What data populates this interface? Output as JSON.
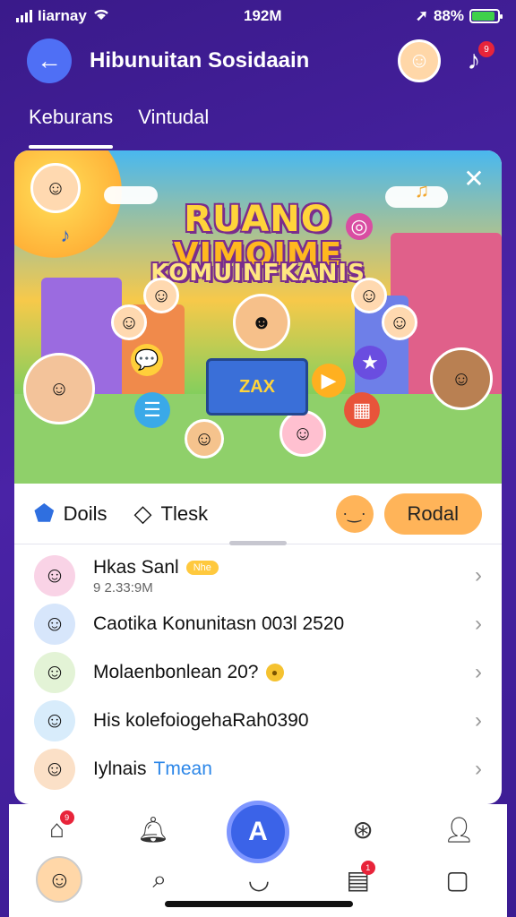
{
  "status_bar": {
    "carrier": "Iiarnay",
    "time": "192M",
    "battery": "88%",
    "battery_level": 0.88
  },
  "header": {
    "title": "Hibunuitan Sosidaain",
    "music_badge": "9"
  },
  "tabs": [
    {
      "label": "Keburans",
      "active": true
    },
    {
      "label": "Vintudal",
      "active": false
    }
  ],
  "banner": {
    "title_line1": "RUANO",
    "title_line2": "VIMOIME",
    "title_line3": "KOMUINFKANIS",
    "stage_text": "ZAX"
  },
  "actions": {
    "item1_label": "Doils",
    "item2_label": "Tlesk",
    "dots_label": "·‿·",
    "primary_label": "Rodal"
  },
  "list": [
    {
      "title": "Hkas Sanl",
      "subtitle": "9 2.33:9M",
      "badge": "Nhe"
    },
    {
      "title": "Caotika Konunitasn 003l 2520",
      "subtitle": ""
    },
    {
      "title": "Molaenbonlean 20?",
      "subtitle": "",
      "coin": "●"
    },
    {
      "title": "His kolefoiogehaRah0390",
      "subtitle": ""
    },
    {
      "title": "Iylnais",
      "title_accent": "Tmean",
      "subtitle": ""
    }
  ],
  "bottom_nav": {
    "home_badge": "9",
    "mail_badge": "1",
    "fab_label": "A"
  },
  "colors": {
    "background": "#3a1a8a",
    "accent_blue": "#4f6ff5",
    "orange_button": "#ffb459",
    "badge_red": "#e8243a"
  }
}
